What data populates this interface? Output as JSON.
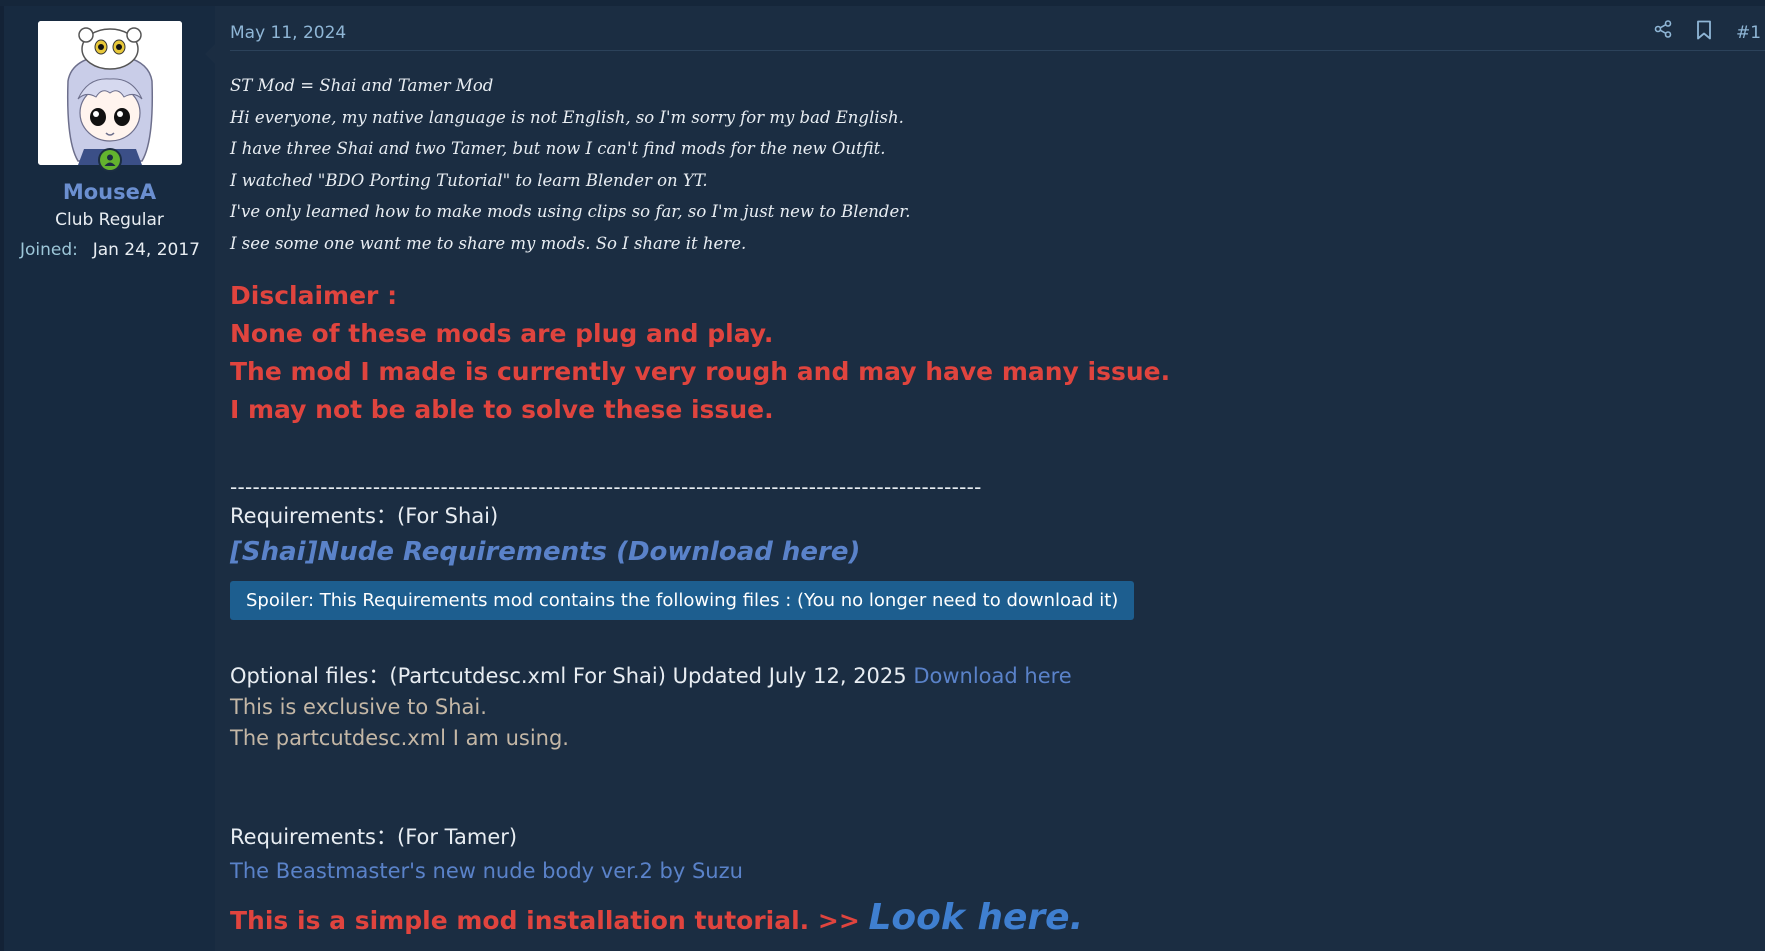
{
  "author": {
    "username": "MouseA",
    "title": "Club Regular",
    "joined_label": "Joined:",
    "joined_value": "Jan 24, 2017",
    "online": true
  },
  "post": {
    "date": "May 11, 2024",
    "number": "#1",
    "icons": [
      "share-icon",
      "bookmark-icon"
    ],
    "intro_lines": [
      "ST Mod = Shai and Tamer Mod",
      "Hi everyone, my native language is not English, so I'm sorry for my bad English.",
      "I have three Shai and two Tamer, but now I can't find mods for the new Outfit.",
      "I watched \"BDO Porting Tutorial\" to learn Blender on YT.",
      "I've only learned how to make mods using clips so far, so I'm just new to Blender.",
      "I see some one want me to share my mods. So I share it here."
    ],
    "disclaimer_lines": [
      "Disclaimer :",
      "None of these mods are plug and play.",
      "The mod I made is currently very rough and may have many issue.",
      "I may not be able to solve these issue."
    ],
    "divider": "----------------------------------------------------------------------------------------------------",
    "shai_requirements_label": "Requirements：(For Shai)",
    "shai_requirements_link": "[Shai]Nude Requirements (Download here)",
    "spoiler_label": "Spoiler: This Requirements mod contains the following files : (You no longer need to download it)",
    "optional_text": "Optional files：(Partcutdesc.xml For Shai) Updated July 12, 2025 ",
    "optional_link": "Download here",
    "exclusive_note": "This is exclusive to Shai.",
    "partcut_note": "The partcutdesc.xml I am using.",
    "tamer_requirements_label": "Requirements：(For Tamer)",
    "tamer_link": "The Beastmaster's new nude body ver.2 by Suzu",
    "tutorial_text": "This is a simple mod installation tutorial. >> ",
    "tutorial_link": "Look here."
  },
  "colors": {
    "background": "#1b2d42",
    "sidebar": "#172a40",
    "username": "#6b8fd0",
    "disclaimer": "#e0443e",
    "link": "#5a82c9",
    "spoiler": "#1d5e8f",
    "muted": "#c4b7a6",
    "online": "#63b32e"
  }
}
